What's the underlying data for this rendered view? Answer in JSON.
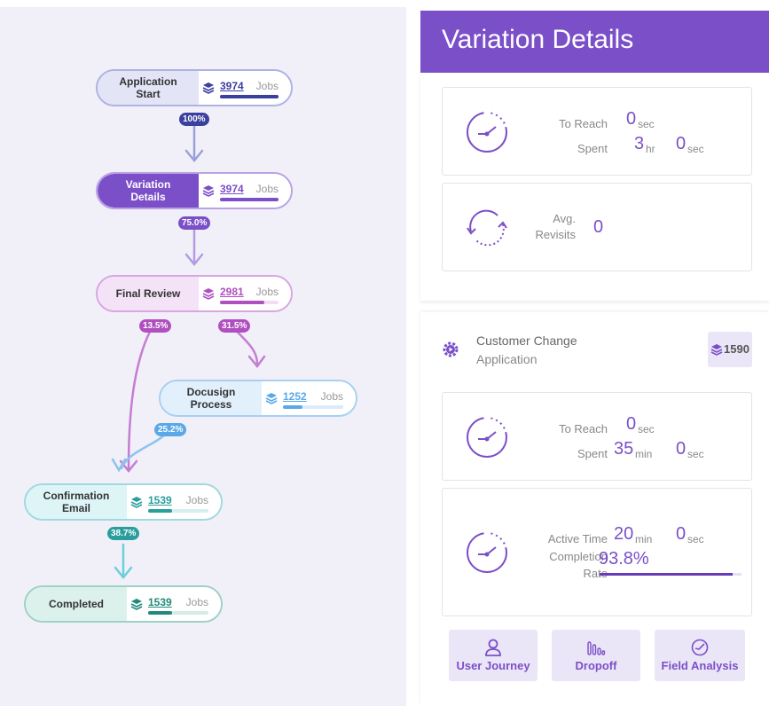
{
  "flow": {
    "nodes": [
      {
        "label_line1": "Application",
        "label_line2": "Start",
        "count": "3974",
        "jobs": "Jobs",
        "fill": 1.0
      },
      {
        "label_line1": "Variation",
        "label_line2": "Details",
        "count": "3974",
        "jobs": "Jobs",
        "fill": 1.0
      },
      {
        "label_line1": "Final Review",
        "label_line2": "",
        "count": "2981",
        "jobs": "Jobs",
        "fill": 0.75
      },
      {
        "label_line1": "Docusign",
        "label_line2": "Process",
        "count": "1252",
        "jobs": "Jobs",
        "fill": 0.32
      },
      {
        "label_line1": "Confirmation",
        "label_line2": "Email",
        "count": "1539",
        "jobs": "Jobs",
        "fill": 0.39
      },
      {
        "label_line1": "Completed",
        "label_line2": "",
        "count": "1539",
        "jobs": "Jobs",
        "fill": 0.39
      }
    ],
    "percentages": [
      "100%",
      "75.0%",
      "13.5%",
      "31.5%",
      "25.2%",
      "38.7%"
    ],
    "colors": {
      "navy": "#3b3f9e",
      "purple": "#7b4fc8",
      "magenta": "#b04fc0",
      "lightblue": "#5aa8e8",
      "teal": "#2a9d9d",
      "darkteal": "#1e8a7a"
    }
  },
  "details": {
    "title": "Variation Details",
    "reach_label": "To Reach",
    "reach_value": "0",
    "reach_unit": "sec",
    "spent_label": "Spent",
    "spent_value_1": "3",
    "spent_unit_1": "hr",
    "spent_value_2": "0",
    "spent_unit_2": "sec",
    "avg_label_1": "Avg.",
    "avg_label_2": "Revisits",
    "avg_value": "0"
  },
  "action": {
    "title_1": "Customer Change",
    "title_2": "Application",
    "count": "1590",
    "reach_label": "To Reach",
    "reach_value": "0",
    "reach_unit": "sec",
    "spent_label": "Spent",
    "spent_value_1": "35",
    "spent_unit_1": "min",
    "spent_value_2": "0",
    "spent_unit_2": "sec",
    "active_label": "Active Time",
    "active_value_1": "20",
    "active_unit_1": "min",
    "active_value_2": "0",
    "active_unit_2": "sec",
    "completion_label_1": "Completion",
    "completion_label_2": "Rate",
    "completion_value": "93.8%",
    "completion_fraction": 0.938
  },
  "buttons": {
    "user_journey": "User Journey",
    "dropoff": "Dropoff",
    "field_analysis": "Field Analysis"
  },
  "icons": [
    "layers-icon",
    "timer-icon",
    "revisit-icon",
    "play-gear-icon",
    "user-icon",
    "bars-icon",
    "check-clock-icon",
    "arrow-down-icon"
  ]
}
